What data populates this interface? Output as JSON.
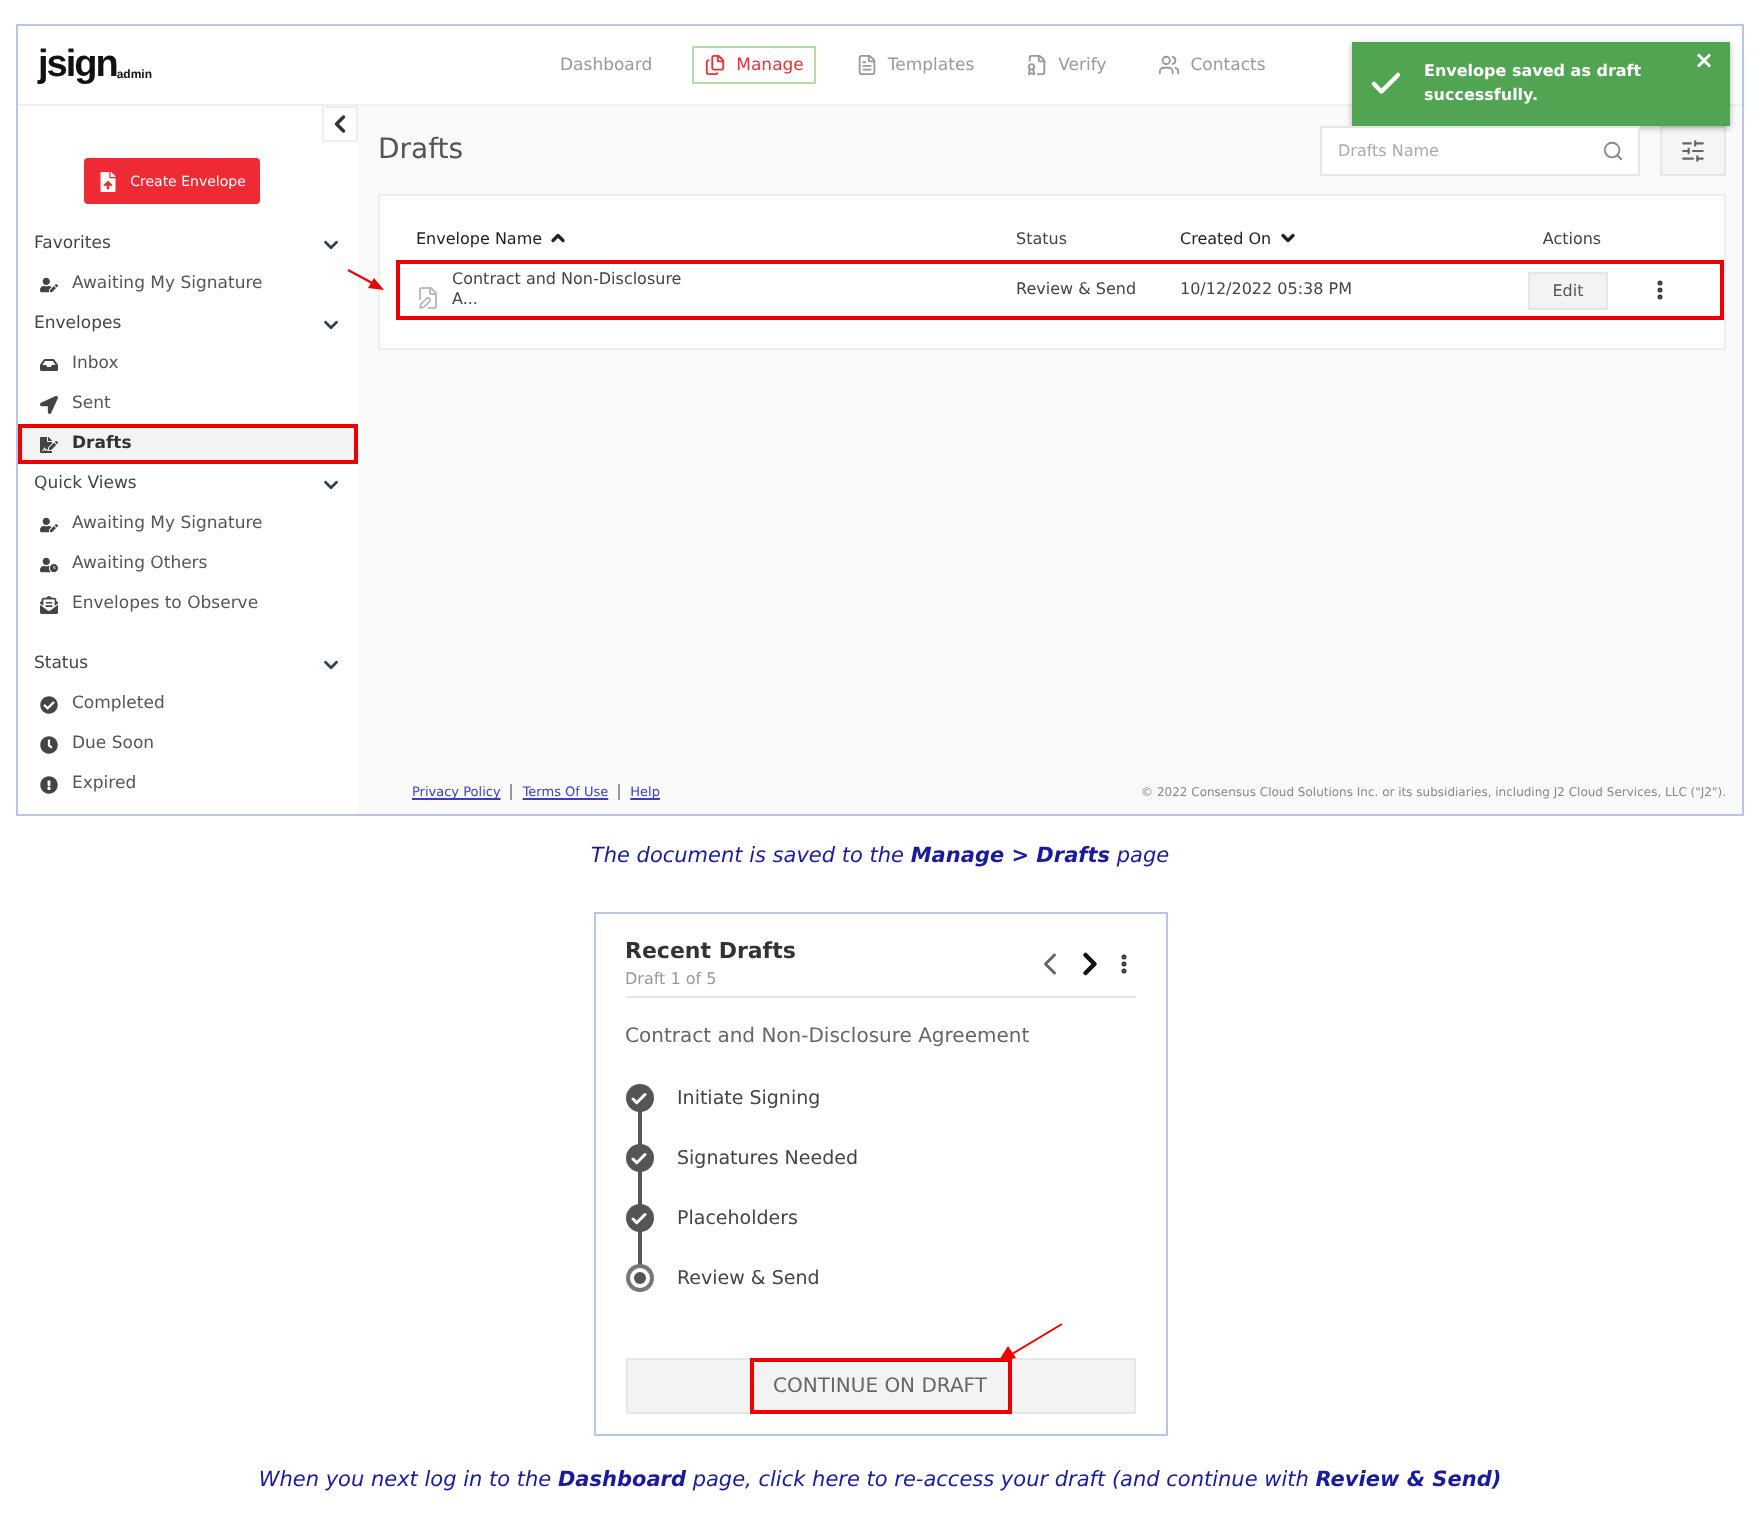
{
  "app_screenshot": {
    "logo": {
      "text": "jsign",
      "sub": "admin"
    },
    "nav": [
      {
        "label": "Dashboard",
        "selected": false
      },
      {
        "label": "Manage",
        "selected": true
      },
      {
        "label": "Templates",
        "selected": false
      },
      {
        "label": "Verify",
        "selected": false
      },
      {
        "label": "Contacts",
        "selected": false
      }
    ],
    "toast": {
      "message": "Envelope saved as draft successfully.",
      "close": "×"
    },
    "sidebar": {
      "create_button": "Create Envelope",
      "sections": [
        {
          "title": "Favorites",
          "items": [
            {
              "label": "Awaiting My Signature",
              "selected": false,
              "highlighted": false
            }
          ]
        },
        {
          "title": "Envelopes",
          "items": [
            {
              "label": "Inbox",
              "selected": false,
              "highlighted": false
            },
            {
              "label": "Sent",
              "selected": false,
              "highlighted": false
            },
            {
              "label": "Drafts",
              "selected": true,
              "highlighted": true
            }
          ]
        },
        {
          "title": "Quick Views",
          "items": [
            {
              "label": "Awaiting My Signature",
              "selected": false,
              "highlighted": false
            },
            {
              "label": "Awaiting Others",
              "selected": false,
              "highlighted": false
            },
            {
              "label": "Envelopes to Observe",
              "selected": false,
              "highlighted": false
            }
          ]
        },
        {
          "title": "Status",
          "items": [
            {
              "label": "Completed",
              "selected": false,
              "highlighted": false
            },
            {
              "label": "Due Soon",
              "selected": false,
              "highlighted": false
            },
            {
              "label": "Expired",
              "selected": false,
              "highlighted": false
            }
          ]
        }
      ]
    },
    "page_title": "Drafts",
    "search": {
      "placeholder": "Drafts Name"
    },
    "table": {
      "columns": [
        {
          "label": "Envelope Name",
          "sorted_up": true,
          "sorted_down": false
        },
        {
          "label": "Status",
          "sorted_up": false,
          "sorted_down": false
        },
        {
          "label": "Created On",
          "sorted_up": false,
          "sorted_down": true
        },
        {
          "label": "Actions",
          "sorted_up": false,
          "sorted_down": false
        }
      ],
      "rows": [
        {
          "name": "Contract and Non-Disclosure A...",
          "status": "Review & Send",
          "created": "10/12/2022 05:38 PM",
          "action": "Edit",
          "highlighted": true
        }
      ]
    },
    "footer": {
      "links": [
        "Privacy Policy",
        "Terms Of Use",
        "Help"
      ],
      "copyright": "© 2022 Consensus Cloud Solutions Inc. or its subsidiaries, including J2 Cloud Services, LLC (\"J2\")."
    }
  },
  "caption_1": "The document is saved to the **Manage > Drafts** page",
  "recent_drafts_card": {
    "title": "Recent Drafts",
    "subtitle": "Draft 1 of 5",
    "document": "Contract and Non-Disclosure Agreement",
    "steps": [
      {
        "label": "Initiate Signing",
        "done": true
      },
      {
        "label": "Signatures Needed",
        "done": true
      },
      {
        "label": "Placeholders",
        "done": true
      },
      {
        "label": "Review & Send",
        "done": false
      }
    ],
    "button": {
      "label": "CONTINUE ON DRAFT",
      "highlighted": true
    }
  },
  "caption_2": "When you next log in to the **Dashboard** page, click here to re-access your draft (and continue with **Review & Send)**"
}
